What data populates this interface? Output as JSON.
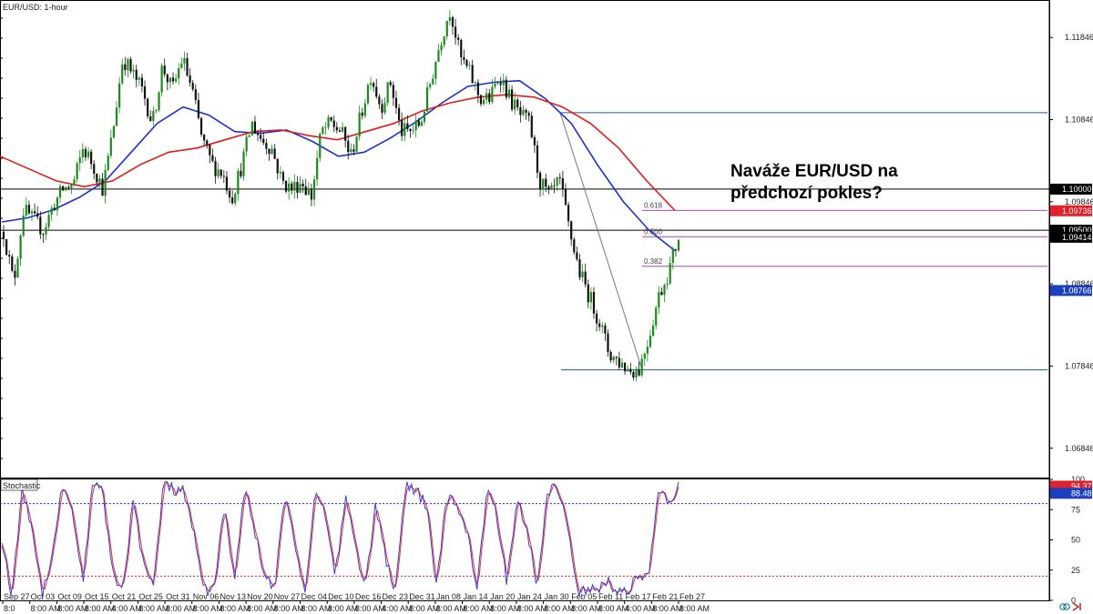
{
  "chart_data": [
    {
      "type": "candlestick",
      "title": "EUR/USD: 1-hour",
      "annotation": [
        "Naváže EUR/USD na",
        "předchozí pokles?"
      ],
      "y_ticks": [
        "1.11846",
        "1.10846",
        "1.09846",
        "1.08846",
        "1.07846",
        "1.06846"
      ],
      "ylim": [
        1.065,
        1.1228
      ],
      "x_ticks": [
        "Sep 27",
        "Oct 03",
        "Oct 09",
        "Oct 15",
        "Oct 21",
        "Oct 25",
        "Oct 31",
        "Nov 06",
        "Nov 13",
        "Nov 20",
        "Nov 27",
        "Dec 04",
        "Dec 10",
        "Dec 16",
        "Dec 23",
        "Dec 31",
        "Jan 08",
        "Jan 14",
        "Jan 20",
        "Jan 24",
        "Jan 30",
        "Feb 05",
        "Feb 11",
        "Feb 17",
        "Feb 21",
        "Feb 27"
      ],
      "x_sublabels": [
        "8:0",
        "8:00 AM",
        "8:00 AM",
        "8:00 AM",
        "4:00 AM",
        "8:00 AM",
        "8:00 AM",
        "8:00 AM",
        "8:00 AM",
        "8:00 AM",
        "8:00 AM",
        "8:00 AM",
        "8:00 AM",
        "8:00 AM",
        "4:00 AM",
        "8:00 AM",
        "8:00 AM",
        "8:00 AM",
        "8:00 AM",
        "8:00 AM",
        "8:00 AM",
        "8:00 AM",
        "8:00 AM",
        "4:00 AM",
        "8:00 AM",
        "8:00 AM"
      ],
      "price_path": [
        1.0948,
        1.0885,
        1.0975,
        1.0962,
        1.095,
        1.098,
        1.1,
        1.1005,
        1.105,
        1.103,
        1.1,
        1.107,
        1.116,
        1.114,
        1.112,
        1.108,
        1.115,
        1.112,
        1.116,
        1.112,
        1.106,
        1.103,
        1.102,
        1.099,
        1.103,
        1.108,
        1.106,
        1.105,
        1.101,
        1.1,
        1.101,
        1.099,
        1.107,
        1.108,
        1.107,
        1.104,
        1.109,
        1.114,
        1.11,
        1.113,
        1.107,
        1.107,
        1.108,
        1.113,
        1.118,
        1.122,
        1.116,
        1.114,
        1.111,
        1.111,
        1.114,
        1.111,
        1.109,
        1.108,
        1.101,
        1.099,
        1.101,
        1.095,
        1.09,
        1.087,
        1.084,
        1.08,
        1.079,
        1.078,
        1.078,
        1.082,
        1.087,
        1.09,
        1.0942
      ],
      "ma_blue": [
        1.096,
        1.0965,
        1.0975,
        1.099,
        1.101,
        1.1045,
        1.108,
        1.11,
        1.109,
        1.107,
        1.1068,
        1.1072,
        1.1058,
        1.104,
        1.1045,
        1.1062,
        1.1082,
        1.1105,
        1.1125,
        1.113,
        1.1132,
        1.111,
        1.108,
        1.103,
        1.0985,
        1.095,
        1.0925
      ],
      "ma_red": [
        1.104,
        1.1025,
        1.101,
        1.1003,
        1.101,
        1.103,
        1.1045,
        1.105,
        1.106,
        1.107,
        1.1072,
        1.1065,
        1.106,
        1.107,
        1.108,
        1.1095,
        1.1105,
        1.1112,
        1.1115,
        1.1112,
        1.11,
        1.108,
        1.105,
        1.101,
        1.0974
      ],
      "horizontal_levels": [
        {
          "value": 1.1,
          "color": "#000000"
        },
        {
          "value": 1.095,
          "color": "#000000"
        },
        {
          "value": 1.1093,
          "color": "#1f5a9a"
        },
        {
          "value": 1.078,
          "color": "#1f5a9a"
        }
      ],
      "fibonacci": [
        {
          "label": "0.618",
          "value": 1.0974,
          "color": "#a64ca6"
        },
        {
          "label": "0.500",
          "value": 1.0942,
          "color": "#a64ca6"
        },
        {
          "label": "0.382",
          "value": 1.0906,
          "color": "#a64ca6"
        }
      ],
      "price_labels": [
        {
          "text": "1.10000",
          "bg": "#000000",
          "fg": "#ffffff"
        },
        {
          "text": "1.09736",
          "bg": "#e0202a",
          "fg": "#ffffff"
        },
        {
          "text": "1.09500",
          "bg": "#000000",
          "fg": "#ffffff"
        },
        {
          "text": "1.09414",
          "bg": "#000000",
          "fg": "#ffffff"
        },
        {
          "text": "1.08766",
          "bg": "#1a3fbf",
          "fg": "#ffffff"
        }
      ],
      "colors": {
        "bull": "#1e8a1e",
        "bear": "#111111",
        "ma_fast": "#1a2fd0",
        "ma_slow": "#e31a1a"
      }
    },
    {
      "type": "line",
      "title": "Stochastic",
      "y_ticks": [
        "100",
        "75",
        "50",
        "25",
        "0"
      ],
      "ylim": [
        0,
        100
      ],
      "levels": [
        80,
        20
      ],
      "k_path": [
        50,
        2,
        92,
        60,
        5,
        40,
        95,
        75,
        15,
        95,
        90,
        20,
        8,
        85,
        30,
        10,
        96,
        92,
        90,
        55,
        8,
        10,
        78,
        15,
        92,
        60,
        20,
        8,
        85,
        50,
        5,
        88,
        75,
        20,
        85,
        45,
        10,
        80,
        35,
        8,
        96,
        90,
        80,
        10,
        85,
        80,
        60,
        8,
        90,
        70,
        15,
        85,
        60,
        10,
        90,
        95,
        60,
        5,
        10,
        8,
        15,
        5,
        10,
        20,
        18,
        90,
        80,
        95
      ],
      "price_labels": [
        {
          "text": "94.37",
          "bg": "#e0202a",
          "fg": "#ffffff"
        },
        {
          "text": "88.48",
          "bg": "#1a3fbf",
          "fg": "#ffffff"
        }
      ]
    }
  ]
}
